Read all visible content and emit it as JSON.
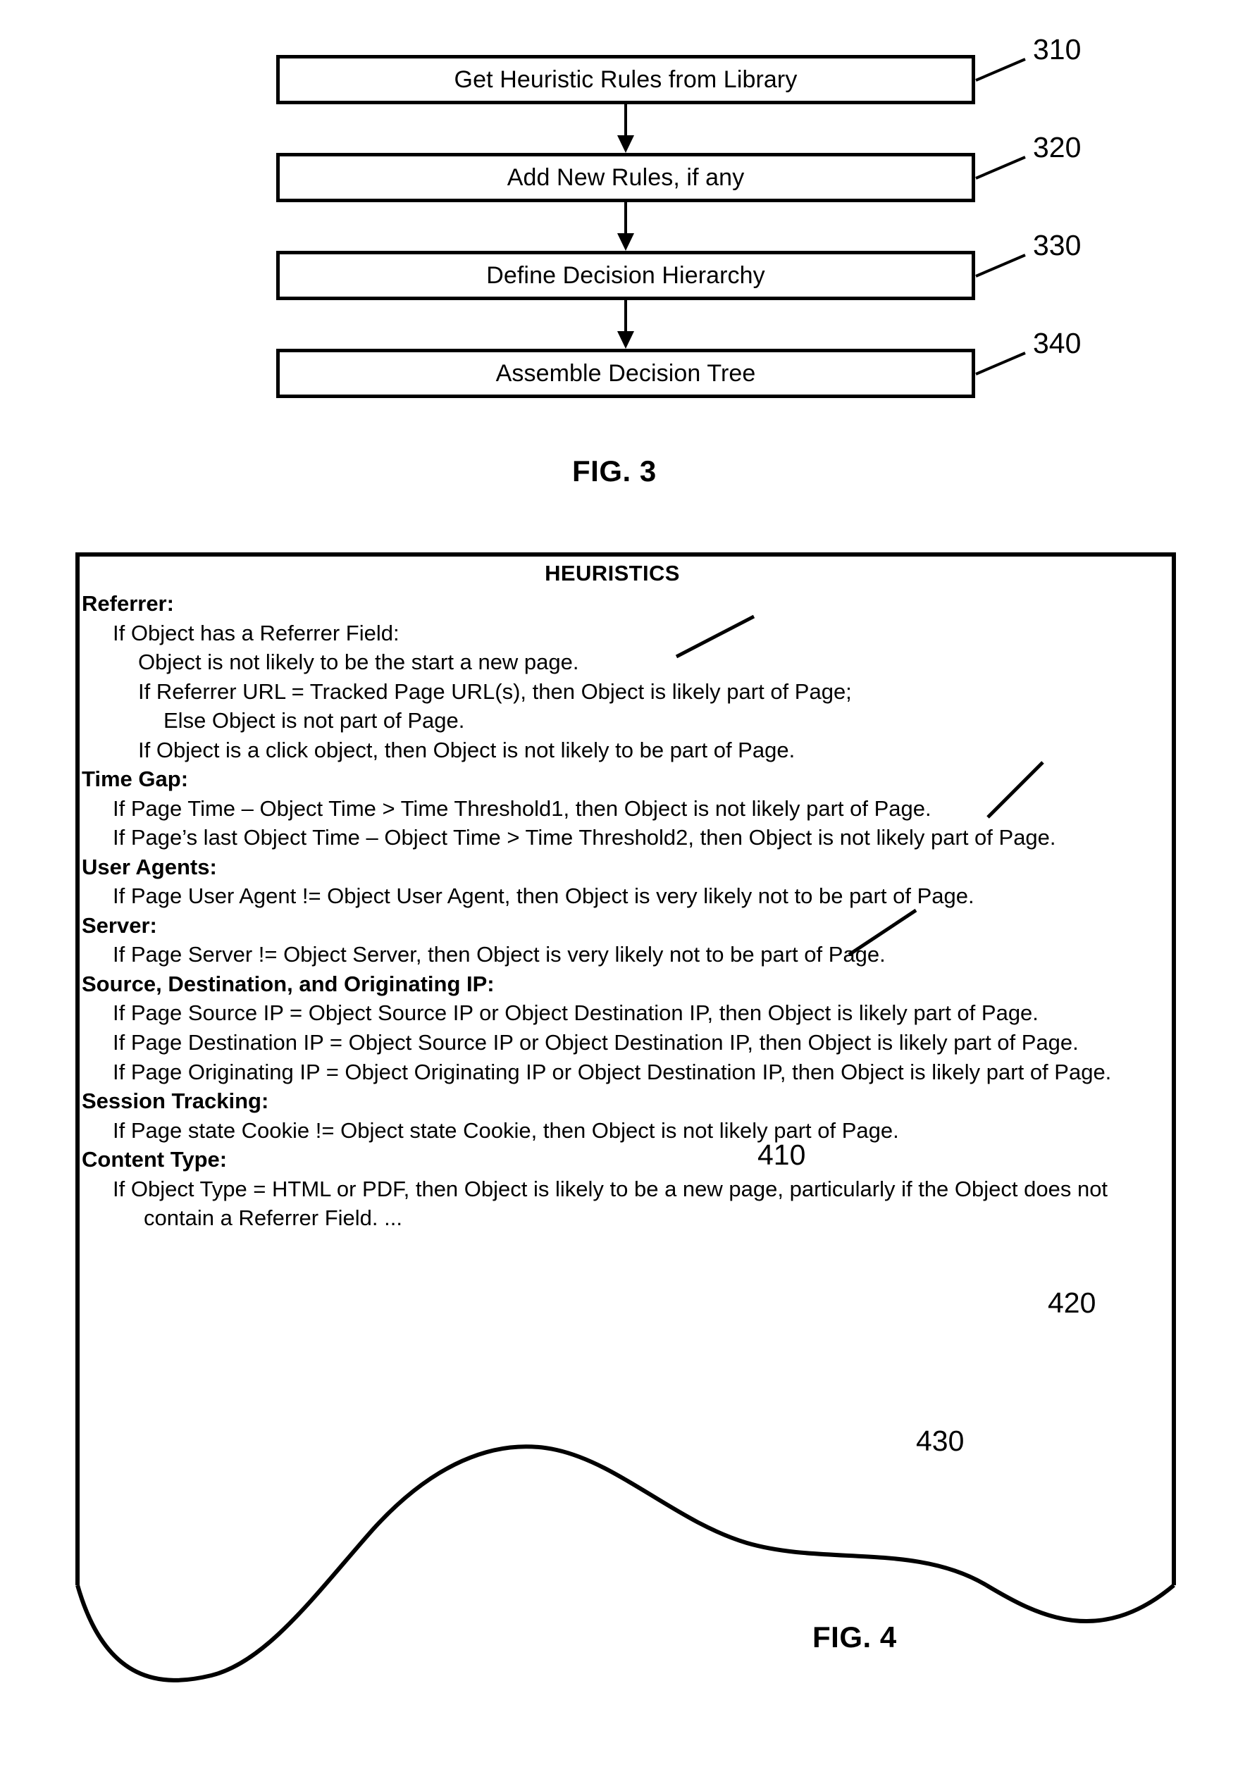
{
  "figures": {
    "fig3": {
      "caption": "FIG. 3",
      "steps": [
        {
          "label": "Get Heuristic Rules from Library",
          "ref": "310"
        },
        {
          "label": "Add New Rules, if any",
          "ref": "320"
        },
        {
          "label": "Define Decision Hierarchy",
          "ref": "330"
        },
        {
          "label": "Assemble Decision Tree",
          "ref": "340"
        }
      ]
    },
    "fig4": {
      "caption": "FIG. 4",
      "title": "HEURISTICS",
      "reference_numerals": {
        "r410": "410",
        "r420": "420",
        "r430": "430"
      },
      "sections": [
        {
          "heading": "Referrer:",
          "lines": [
            {
              "indent": 1,
              "text": "If Object has a Referrer Field:"
            },
            {
              "indent": 2,
              "text": "Object is not likely to be the start a new page."
            },
            {
              "indent": 2,
              "text": "If Referrer URL = Tracked Page URL(s), then Object is likely part of Page;"
            },
            {
              "indent": 3,
              "text": "Else Object is not part of Page."
            },
            {
              "indent": 2,
              "text": "If Object is a click object, then Object is not likely to be part of Page."
            }
          ]
        },
        {
          "heading": "Time Gap:",
          "lines": [
            {
              "indent": 1,
              "text": "If Page Time – Object Time > Time Threshold1, then Object is not likely part of Page."
            },
            {
              "indent": 1,
              "text": "If Page’s last Object Time – Object Time > Time Threshold2, then Object is not likely part of Page."
            }
          ]
        },
        {
          "heading": "User Agents:",
          "lines": [
            {
              "indent": 1,
              "text": "If Page User Agent != Object User Agent, then Object is very likely not to be part of Page."
            }
          ]
        },
        {
          "heading": "Server:",
          "lines": [
            {
              "indent": 1,
              "text": "If Page Server != Object Server, then Object is very likely not to be part of Page."
            }
          ]
        },
        {
          "heading": "Source, Destination, and Originating IP:",
          "lines": [
            {
              "indent": 1,
              "text": "If Page Source IP = Object Source IP or Object Destination IP, then Object is likely part of Page."
            },
            {
              "indent": 1,
              "text": "If Page Destination IP = Object Source IP or Object Destination IP, then Object is likely part of Page."
            },
            {
              "indent": 1,
              "text": "If Page Originating IP = Object Originating IP or Object Destination IP, then Object is likely part of Page."
            }
          ]
        },
        {
          "heading": "Session Tracking:",
          "lines": [
            {
              "indent": 1,
              "text": "If Page state Cookie != Object state Cookie, then Object is not likely part of Page."
            }
          ]
        },
        {
          "heading": "Content Type:",
          "lines": [
            {
              "indent": 1,
              "text": "If Object Type = HTML or PDF, then Object is likely to be a new page, particularly if the Object does not contain a Referrer Field. ..."
            }
          ]
        }
      ]
    }
  },
  "colors": {
    "ink": "#000000",
    "paper": "#ffffff"
  }
}
